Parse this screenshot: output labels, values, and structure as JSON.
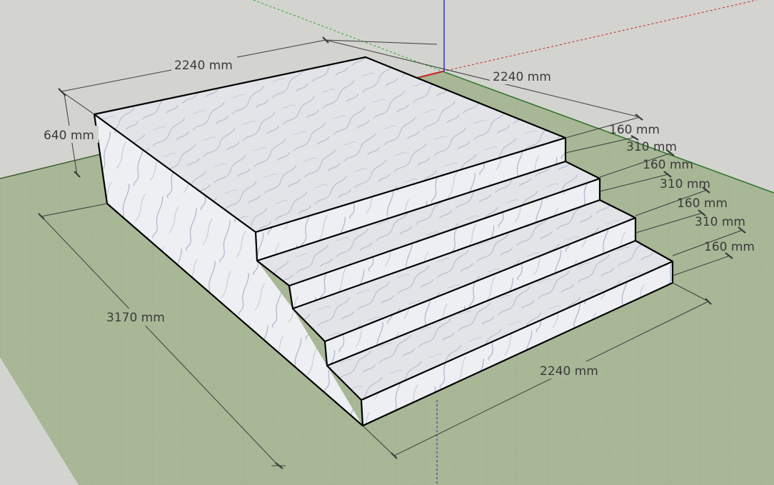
{
  "scene": {
    "colors": {
      "sky": "#d3d4cf",
      "ground": "#a8b796",
      "ground_grid": "#9aa989",
      "marble_top": "#e3e5e8",
      "marble_side": "#eceef1",
      "marble_vein": "#9aa8bf",
      "edge": "#000000",
      "axis_red": "#cc2222",
      "axis_green": "#22aa22",
      "axis_blue": "#2222cc"
    },
    "dimensions": {
      "top_width": "2240 mm",
      "top_depth": "2240 mm",
      "height": "640 mm",
      "total_depth": "3170 mm",
      "bottom_width": "2240 mm",
      "riser_1": "160 mm",
      "tread_1": "310 mm",
      "riser_2": "160 mm",
      "tread_2": "310 mm",
      "riser_3": "160 mm",
      "tread_3": "310 mm",
      "riser_4": "160 mm"
    }
  }
}
